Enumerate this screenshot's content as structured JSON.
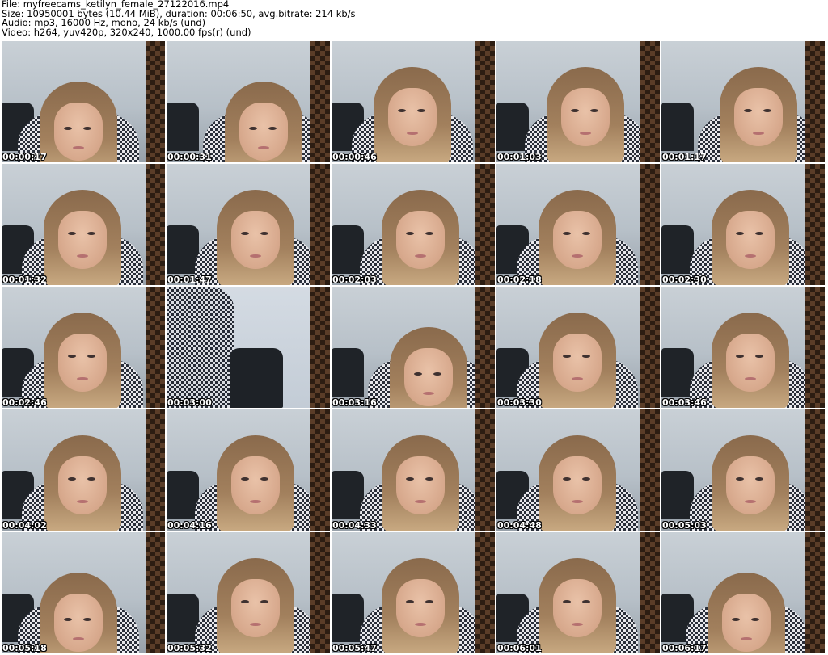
{
  "header": {
    "file_line": "File: myfreecams_ketilyn_female_27122016.mp4",
    "size_line": "Size: 10950001 bytes (10.44 MiB), duration: 00:06:50, avg.bitrate: 214 kb/s",
    "audio_line": "Audio: mp3, 16000 Hz, mono, 24 kb/s (und)",
    "video_line": "Video: h264, yuv420p, 320x240, 1000.00 fps(r) (und)"
  },
  "thumbnails": [
    {
      "timestamp": "00:00:17",
      "pose": "down"
    },
    {
      "timestamp": "00:00:31",
      "pose": "down"
    },
    {
      "timestamp": "00:00:46",
      "pose": "front"
    },
    {
      "timestamp": "00:01:03",
      "pose": "front"
    },
    {
      "timestamp": "00:01:17",
      "pose": "front"
    },
    {
      "timestamp": "00:01:32",
      "pose": "front"
    },
    {
      "timestamp": "00:01:47",
      "pose": "front"
    },
    {
      "timestamp": "00:02:03",
      "pose": "front"
    },
    {
      "timestamp": "00:02:18",
      "pose": "front"
    },
    {
      "timestamp": "00:02:30",
      "pose": "front"
    },
    {
      "timestamp": "00:02:46",
      "pose": "front"
    },
    {
      "timestamp": "00:03:00",
      "pose": "standing"
    },
    {
      "timestamp": "00:03:16",
      "pose": "down"
    },
    {
      "timestamp": "00:03:30",
      "pose": "front"
    },
    {
      "timestamp": "00:03:46",
      "pose": "front"
    },
    {
      "timestamp": "00:04:02",
      "pose": "front"
    },
    {
      "timestamp": "00:04:16",
      "pose": "front"
    },
    {
      "timestamp": "00:04:33",
      "pose": "front"
    },
    {
      "timestamp": "00:04:48",
      "pose": "front"
    },
    {
      "timestamp": "00:05:03",
      "pose": "front"
    },
    {
      "timestamp": "00:05:18",
      "pose": "down"
    },
    {
      "timestamp": "00:05:32",
      "pose": "front"
    },
    {
      "timestamp": "00:05:47",
      "pose": "front"
    },
    {
      "timestamp": "00:06:01",
      "pose": "front"
    },
    {
      "timestamp": "00:06:17",
      "pose": "down"
    }
  ]
}
